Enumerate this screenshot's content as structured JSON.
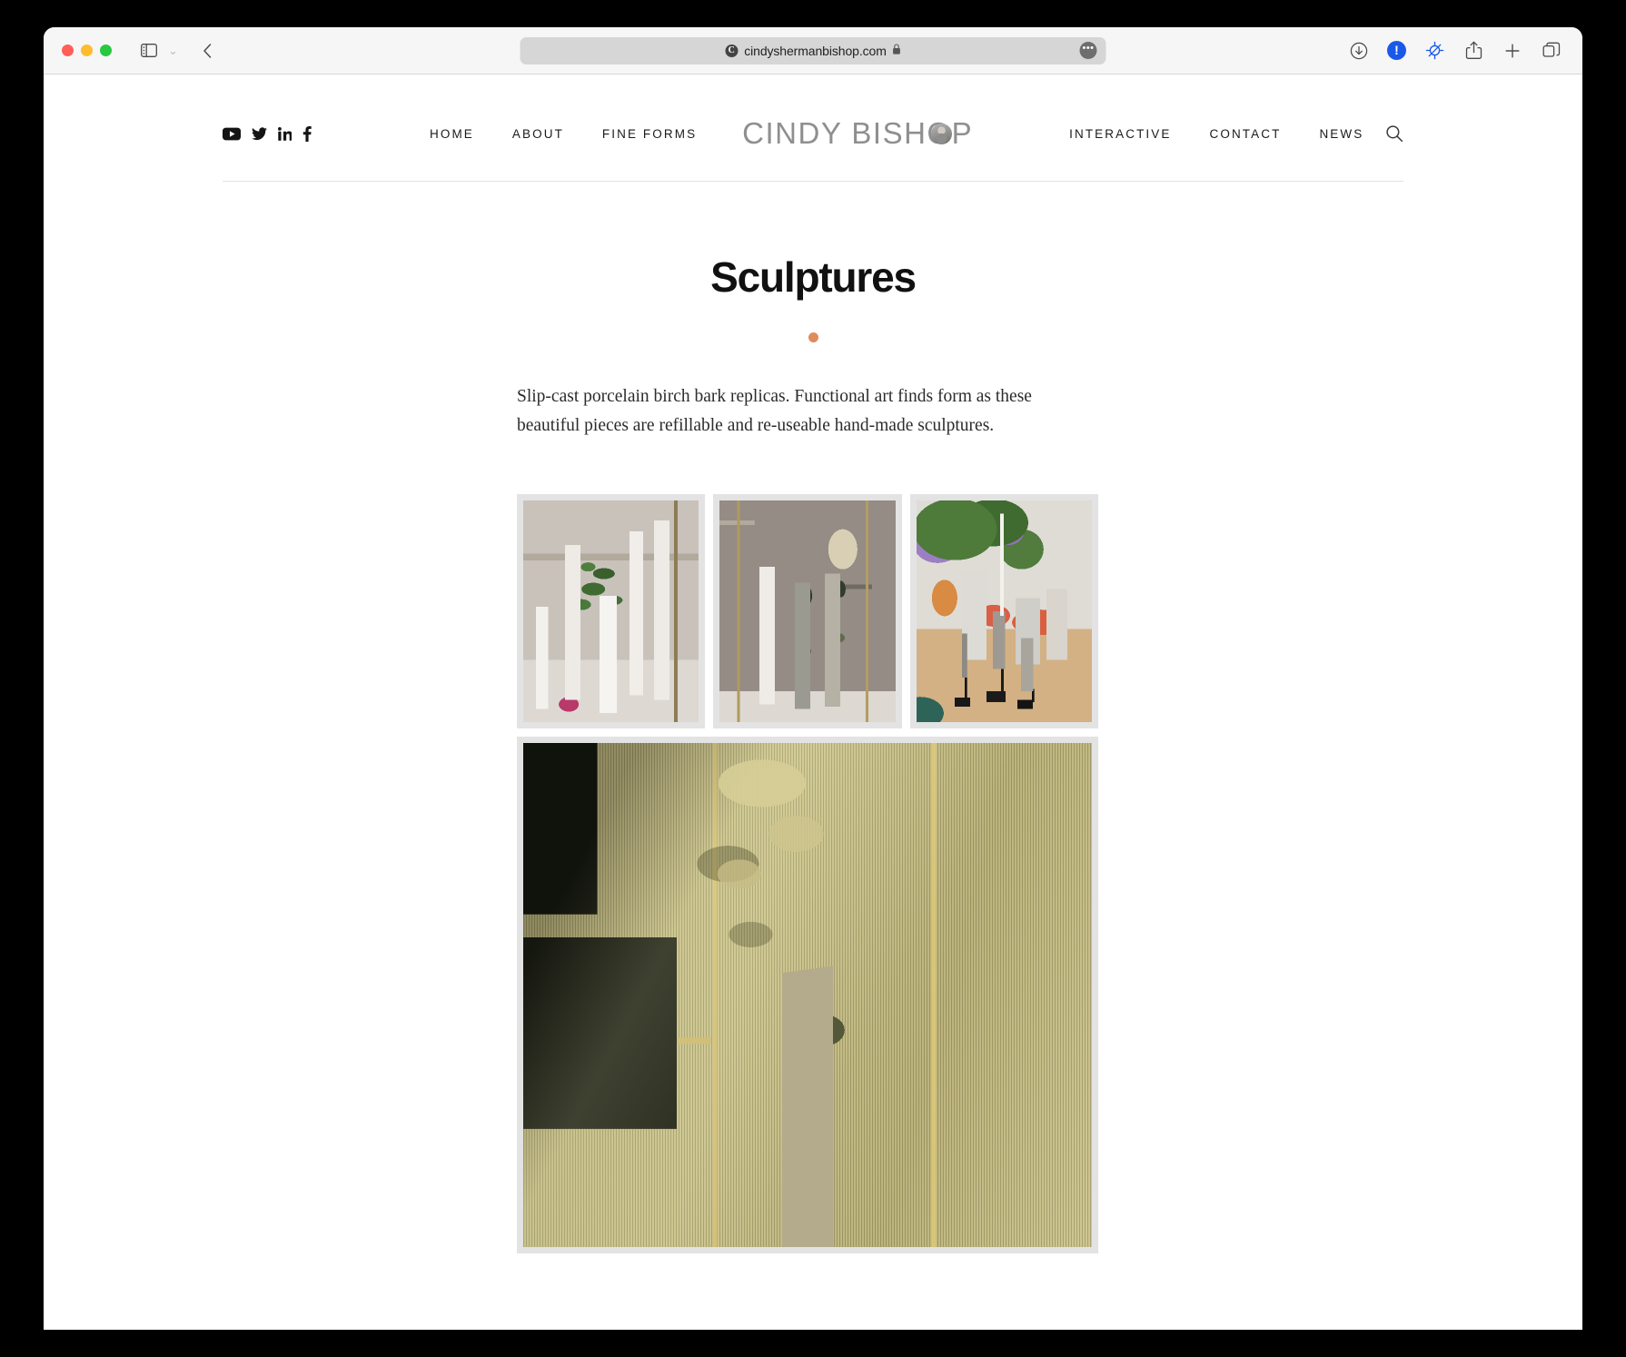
{
  "browser": {
    "traffic_lights": [
      "close",
      "minimize",
      "zoom"
    ],
    "sidebar_toggle_label": "Show Sidebar",
    "sidebar_chevron": "⌄",
    "back_label": "‹",
    "url": "cindyshermanbishop.com",
    "url_lock": "🔒",
    "url_more": "•••",
    "right_icons": [
      {
        "name": "downloads-icon",
        "label": "Downloads"
      },
      {
        "name": "warning-badge-icon",
        "label": "!"
      },
      {
        "name": "privacy-report-icon",
        "label": "Privacy Report"
      },
      {
        "name": "share-icon",
        "label": "Share"
      },
      {
        "name": "new-tab-icon",
        "label": "+"
      },
      {
        "name": "tab-overview-icon",
        "label": "Tabs"
      }
    ],
    "accent_blue": "#1a59e8"
  },
  "site": {
    "social": [
      {
        "name": "youtube-icon",
        "label": "YouTube"
      },
      {
        "name": "twitter-icon",
        "label": "Twitter"
      },
      {
        "name": "linkedin-icon",
        "label": "LinkedIn"
      },
      {
        "name": "facebook-icon",
        "label": "Facebook"
      }
    ],
    "nav_left": [
      "HOME",
      "ABOUT",
      "FINE FORMS"
    ],
    "logo_text": "CINDY BISHOP",
    "nav_right": [
      "INTERACTIVE",
      "CONTACT",
      "NEWS"
    ],
    "search_label": "Search"
  },
  "main": {
    "title": "Sculptures",
    "accent_dot_color": "#e08b5a",
    "intro": "Slip-cast porcelain birch bark replicas. Functional art finds form as these beautiful pieces are refillable and re-useable hand-made sculptures.",
    "gallery": {
      "thumbnails": [
        {
          "name": "photo-white-porcelain-birch-vases",
          "alt": "Five white slip-cast porcelain birch bark vases on a marble surface with a green leafy branch and a pink petal"
        },
        {
          "name": "photo-three-birch-trunks",
          "alt": "Three birch bark sculptures — one white, two mottled gray-green — against a grey wall with brass frames, one holding a dried branch"
        },
        {
          "name": "photo-birch-candle-holders",
          "alt": "Small birch bark candle holders on black metal stands on a wood table with lilacs and white vases behind"
        }
      ],
      "hero": {
        "name": "photo-birch-wall-vase",
        "alt": "Close-up of a birch bark wall vase holding a dried branch against textured grasscloth wallpaper with brass trim in warm golden light"
      }
    }
  }
}
